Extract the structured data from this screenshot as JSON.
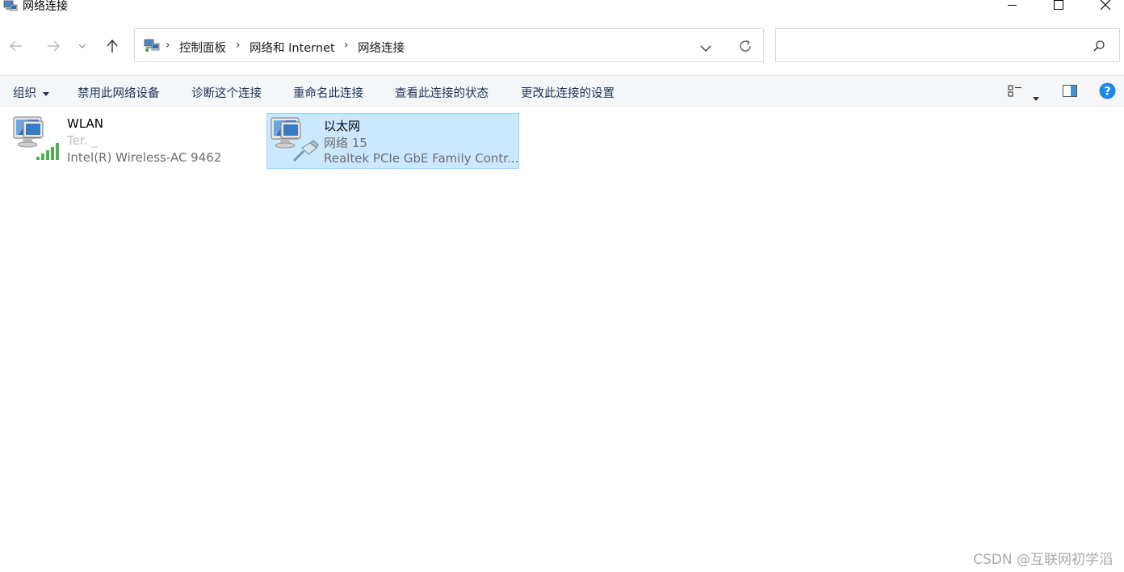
{
  "window": {
    "title": "网络连接"
  },
  "address": {
    "breadcrumbs": [
      "控制面板",
      "网络和 Internet",
      "网络连接"
    ],
    "search_placeholder": ""
  },
  "toolbar": {
    "organize_label": "组织",
    "commands": [
      "禁用此网络设备",
      "诊断这个连接",
      "重命名此连接",
      "查看此连接的状态",
      "更改此连接的设置"
    ]
  },
  "connections": [
    {
      "name": "WLAN",
      "network": "Ter.  _   ",
      "device": "Intel(R) Wireless-AC 9462",
      "icon": "wifi-signal-icon",
      "selected": false
    },
    {
      "name": "以太网",
      "network": "网络 15",
      "device": "Realtek PCIe GbE Family Contr...",
      "icon": "ethernet-cable-icon",
      "selected": true
    }
  ],
  "watermark": "CSDN @互联网初学滔",
  "colors": {
    "selection_bg": "#cce8ff",
    "selection_border": "#99d1ff",
    "command_bar_bg": "#f5f6f7",
    "help_blue": "#1e88e5"
  }
}
